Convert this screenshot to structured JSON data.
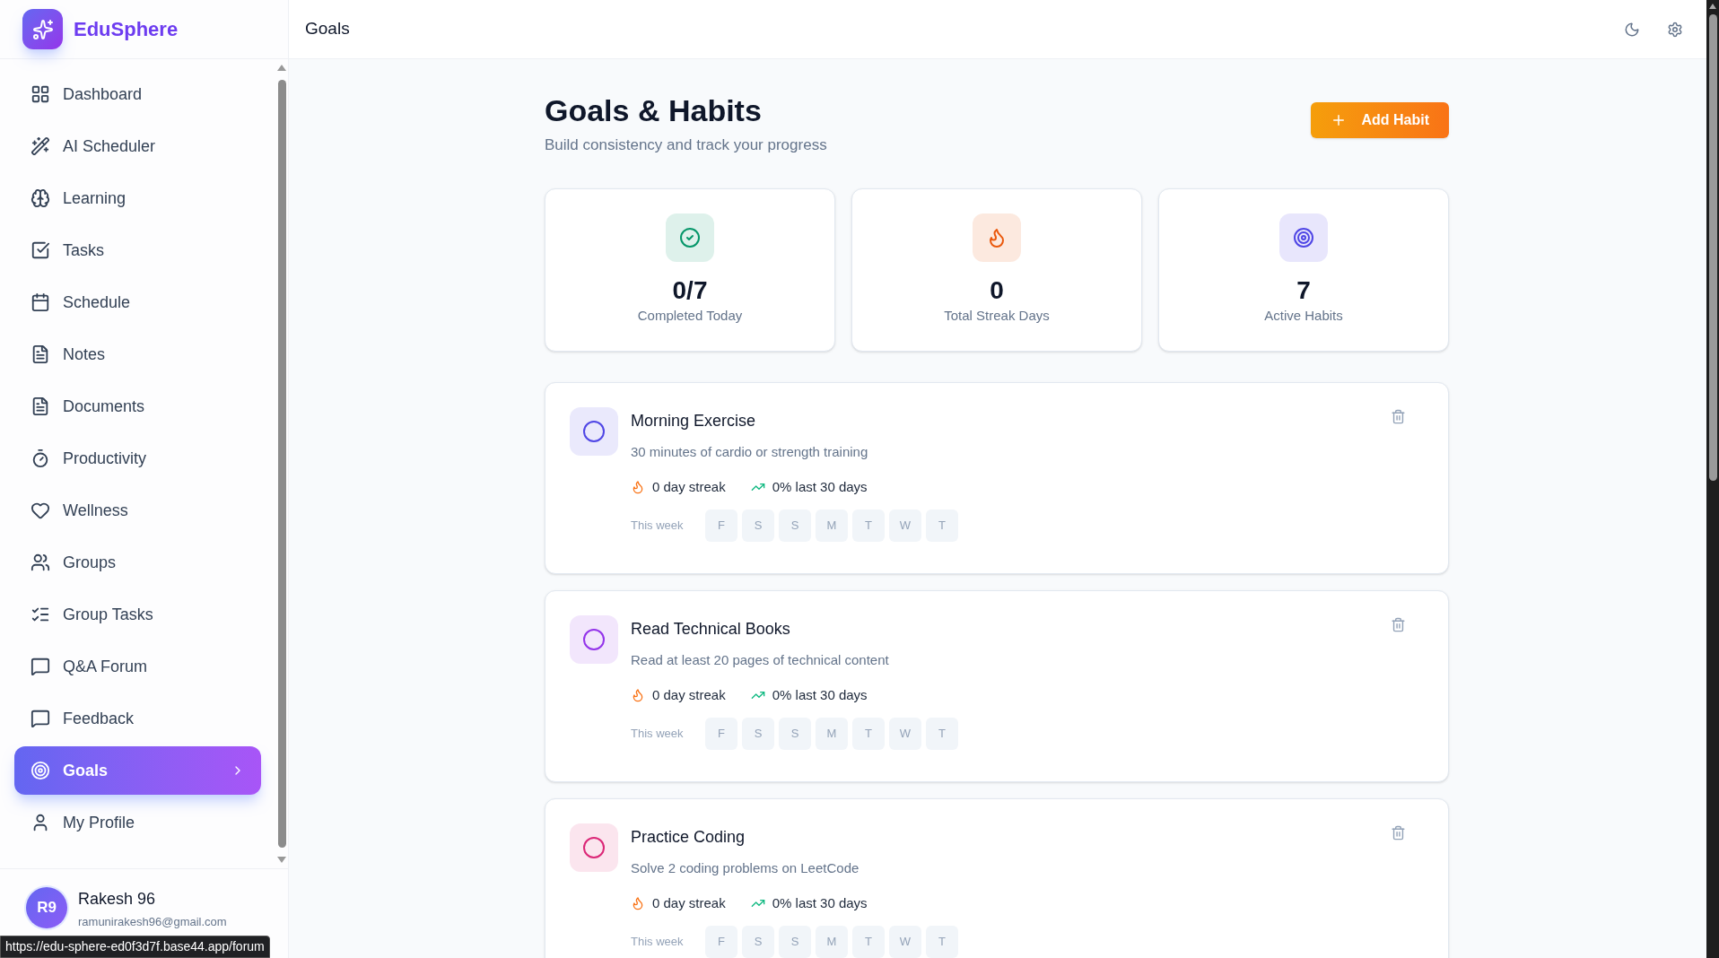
{
  "brand": "EduSphere",
  "nav": [
    {
      "label": "Dashboard",
      "selected": false
    },
    {
      "label": "AI Scheduler",
      "selected": false
    },
    {
      "label": "Learning",
      "selected": false
    },
    {
      "label": "Tasks",
      "selected": false
    },
    {
      "label": "Schedule",
      "selected": false
    },
    {
      "label": "Notes",
      "selected": false
    },
    {
      "label": "Documents",
      "selected": false
    },
    {
      "label": "Productivity",
      "selected": false
    },
    {
      "label": "Wellness",
      "selected": false
    },
    {
      "label": "Groups",
      "selected": false
    },
    {
      "label": "Group Tasks",
      "selected": false
    },
    {
      "label": "Q&A Forum",
      "selected": false
    },
    {
      "label": "Feedback",
      "selected": false
    },
    {
      "label": "Goals",
      "selected": true
    },
    {
      "label": "My Profile",
      "selected": false
    }
  ],
  "user": {
    "initials": "R9",
    "name": "Rakesh 96",
    "email": "ramunirakesh96@gmail.com"
  },
  "status_url": "https://edu-sphere-ed0f3d7f.base44.app/forum",
  "header": {
    "title": "Goals"
  },
  "page": {
    "title": "Goals & Habits",
    "subtitle": "Build consistency and track your progress",
    "add_button": "Add Habit"
  },
  "stats": [
    {
      "value": "0/7",
      "label": "Completed Today",
      "color": "#059669"
    },
    {
      "value": "0",
      "label": "Total Streak Days",
      "color": "#ea580c"
    },
    {
      "value": "7",
      "label": "Active Habits",
      "color": "#4f46e5"
    }
  ],
  "habits": [
    {
      "name": "Morning Exercise",
      "description": "30 minutes of cardio or strength training",
      "streak": "0 day streak",
      "rate": "0% last 30 days",
      "color": "#4f46e5",
      "week_label": "This week",
      "days": [
        "F",
        "S",
        "S",
        "M",
        "T",
        "W",
        "T"
      ]
    },
    {
      "name": "Read Technical Books",
      "description": "Read at least 20 pages of technical content",
      "streak": "0 day streak",
      "rate": "0% last 30 days",
      "color": "#9333ea",
      "week_label": "This week",
      "days": [
        "F",
        "S",
        "S",
        "M",
        "T",
        "W",
        "T"
      ]
    },
    {
      "name": "Practice Coding",
      "description": "Solve 2 coding problems on LeetCode",
      "streak": "0 day streak",
      "rate": "0% last 30 days",
      "color": "#db2777",
      "week_label": "This week",
      "days": [
        "F",
        "S",
        "S",
        "M",
        "T",
        "W",
        "T"
      ]
    }
  ]
}
